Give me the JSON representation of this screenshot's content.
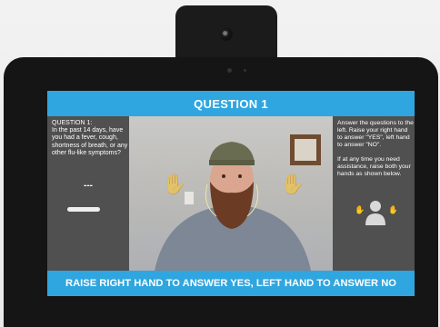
{
  "header": {
    "title": "QUESTION 1"
  },
  "question": {
    "label": "QUESTION 1:",
    "text": "In the past 14 days, have you had a fever, cough, shortness of breath, or any other flu-like symptoms?",
    "answer_placeholder": "---"
  },
  "instructions": {
    "line1": "Answer the questions to the left.  Raise your right hand to answer \"YES\", left hand to answer \"NO\".",
    "line2": "If at any time you need assistance, raise both your hands as shown below."
  },
  "footer": {
    "prompt": "RAISE RIGHT HAND TO ANSWER YES, LEFT HAND TO ANSWER NO"
  },
  "icons": {
    "camera": "camera-icon",
    "left_hand": "raised-hand-icon",
    "right_hand": "raised-hand-icon",
    "assistance": "person-raising-both-hands-icon"
  },
  "colors": {
    "banner": "#2fa6df",
    "panel": "#505050",
    "device": "#151515",
    "text": "#ffffff"
  }
}
